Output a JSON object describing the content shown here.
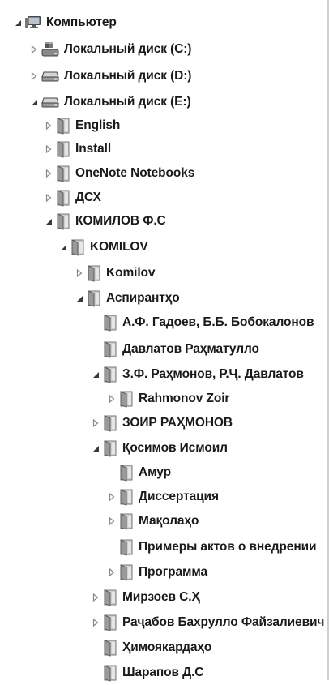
{
  "tree": {
    "nodes": [
      {
        "label": "Компьютер",
        "icon": "computer-icon",
        "state": "expanded"
      },
      {
        "label": "Локальный диск (C:)",
        "icon": "system-drive-icon",
        "state": "collapsed"
      },
      {
        "label": "Локальный диск (D:)",
        "icon": "drive-icon",
        "state": "collapsed"
      },
      {
        "label": "Локальный диск (E:)",
        "icon": "drive-icon",
        "state": "expanded"
      },
      {
        "label": "English",
        "icon": "folder-icon",
        "state": "collapsed"
      },
      {
        "label": "Install",
        "icon": "folder-icon",
        "state": "collapsed"
      },
      {
        "label": "OneNote Notebooks",
        "icon": "folder-icon",
        "state": "collapsed"
      },
      {
        "label": "ДСХ",
        "icon": "folder-icon",
        "state": "collapsed"
      },
      {
        "label": "КОМИЛОВ Ф.С",
        "icon": "folder-icon",
        "state": "expanded"
      },
      {
        "label": "KOMILOV",
        "icon": "folder-icon",
        "state": "expanded"
      },
      {
        "label": "Komilov",
        "icon": "folder-icon",
        "state": "collapsed"
      },
      {
        "label": "Аспирантҳо",
        "icon": "folder-icon",
        "state": "expanded"
      },
      {
        "label": "А.Ф. Гадоев, Б.Б. Бобокалонов",
        "icon": "folder-icon",
        "state": "leaf"
      },
      {
        "label": "Давлатов Раҳматулло",
        "icon": "folder-icon",
        "state": "leaf"
      },
      {
        "label": "З.Ф. Раҳмонов, Р.Ҷ. Давлатов",
        "icon": "folder-icon",
        "state": "expanded"
      },
      {
        "label": "Rahmonov Zoir",
        "icon": "folder-icon",
        "state": "collapsed"
      },
      {
        "label": "ЗОИР РАҲМОНОВ",
        "icon": "folder-icon",
        "state": "collapsed"
      },
      {
        "label": "Қосимов Исмоил",
        "icon": "folder-icon",
        "state": "expanded"
      },
      {
        "label": "Амур",
        "icon": "folder-icon",
        "state": "leaf"
      },
      {
        "label": "Диссертация",
        "icon": "folder-icon",
        "state": "collapsed"
      },
      {
        "label": "Мақолаҳо",
        "icon": "folder-icon",
        "state": "collapsed"
      },
      {
        "label": "Примеры актов о внедрении",
        "icon": "folder-icon",
        "state": "leaf"
      },
      {
        "label": "Программа",
        "icon": "folder-icon",
        "state": "collapsed"
      },
      {
        "label": "Мирзоев С.Ҳ",
        "icon": "folder-icon",
        "state": "collapsed"
      },
      {
        "label": "Раҷабов Бахрулло Файзалиевич",
        "icon": "folder-icon",
        "state": "collapsed"
      },
      {
        "label": "Ҳимоякардаҳо",
        "icon": "folder-icon",
        "state": "leaf"
      },
      {
        "label": "Шарапов Д.С",
        "icon": "folder-icon",
        "state": "leaf"
      }
    ]
  },
  "colors": {
    "text": "#1a1a1a",
    "expand_arrow": "#3a3a3a",
    "collapse_arrow": "#8a8a8a",
    "folder": "#9a9a9a"
  }
}
